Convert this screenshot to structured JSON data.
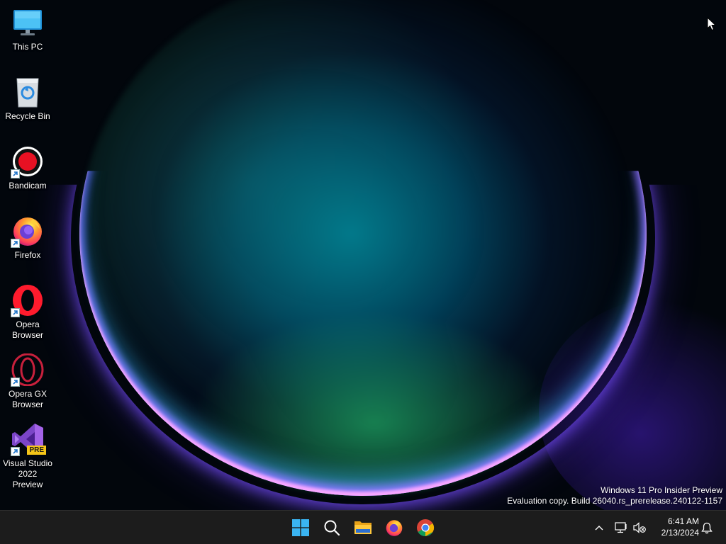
{
  "desktop": {
    "icons": [
      {
        "label": "This PC",
        "icon": "monitor-icon"
      },
      {
        "label": "Recycle Bin",
        "icon": "recycle-bin-icon"
      },
      {
        "label": "Bandicam",
        "icon": "bandicam-icon",
        "shortcut": true
      },
      {
        "label": "Firefox",
        "icon": "firefox-icon",
        "shortcut": true
      },
      {
        "label": "Opera\nBrowser",
        "icon": "opera-icon",
        "shortcut": true
      },
      {
        "label": "Opera GX\nBrowser",
        "icon": "opera-gx-icon",
        "shortcut": true
      },
      {
        "label": "Visual Studio\n2022 Preview",
        "icon": "visual-studio-icon",
        "shortcut": true,
        "badge": "PRE"
      }
    ]
  },
  "watermark": {
    "line1": "Windows 11 Pro Insider Preview",
    "line2": "Evaluation copy. Build 26040.rs_prerelease.240122-1157"
  },
  "taskbar": {
    "buttons": [
      {
        "name": "start",
        "icon": "windows-logo-icon"
      },
      {
        "name": "search",
        "icon": "search-icon"
      },
      {
        "name": "file-explorer",
        "icon": "folder-icon"
      },
      {
        "name": "firefox",
        "icon": "firefox-icon"
      },
      {
        "name": "chrome",
        "icon": "chrome-icon"
      }
    ],
    "tray": {
      "time": "6:41 AM",
      "date": "2/13/2024",
      "icons": [
        "chevron-up-icon",
        "network-icon",
        "volume-muted-icon",
        "bell-icon"
      ]
    }
  },
  "colors": {
    "taskbar_bg": "#1c1c1c",
    "windows_blue": "#3ab4f2",
    "bandicam_red": "#e81123",
    "opera_red": "#ff1b2d",
    "opera_gx_red": "#c8203c",
    "visual_studio_purple": "#a463e8",
    "pre_badge_yellow": "#f5c518"
  }
}
